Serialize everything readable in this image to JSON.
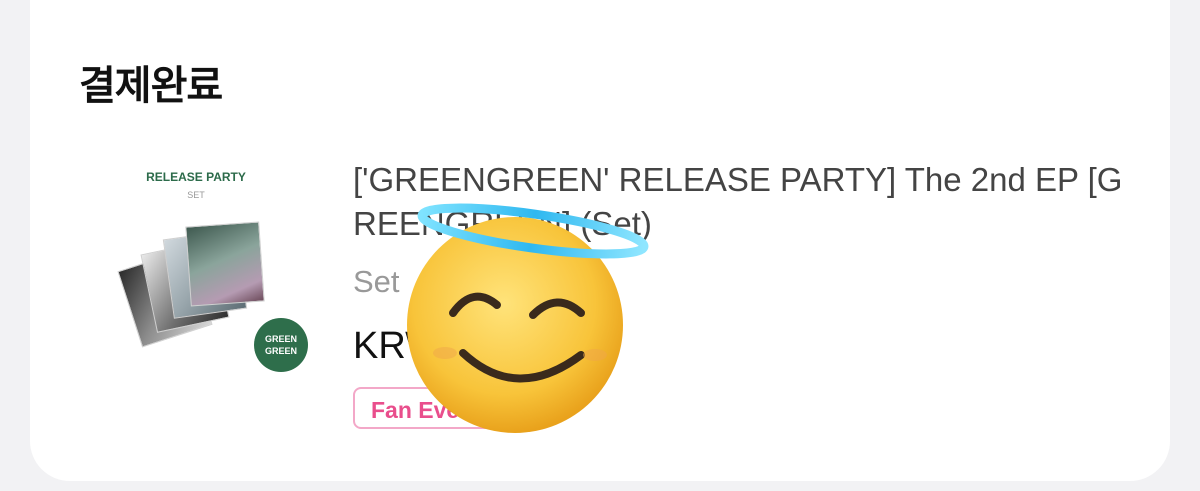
{
  "order": {
    "status": "결제완료",
    "item": {
      "thumbnail": {
        "title": "RELEASE PARTY",
        "subtitle": "SET",
        "badge_line1": "GREEN",
        "badge_line2": "GREEN"
      },
      "title": "['GREENGREEN' RELEASE PARTY] The 2nd EP [GREENGREEN] (Set)",
      "option": "Set",
      "price": "KRW",
      "tag": "Fan Event"
    }
  },
  "overlay": {
    "icon": "smiling-face-with-halo-icon"
  },
  "colors": {
    "tag_text": "#e94e8c",
    "tag_border": "#f3a8c8",
    "badge_green": "#2e6e4b"
  }
}
